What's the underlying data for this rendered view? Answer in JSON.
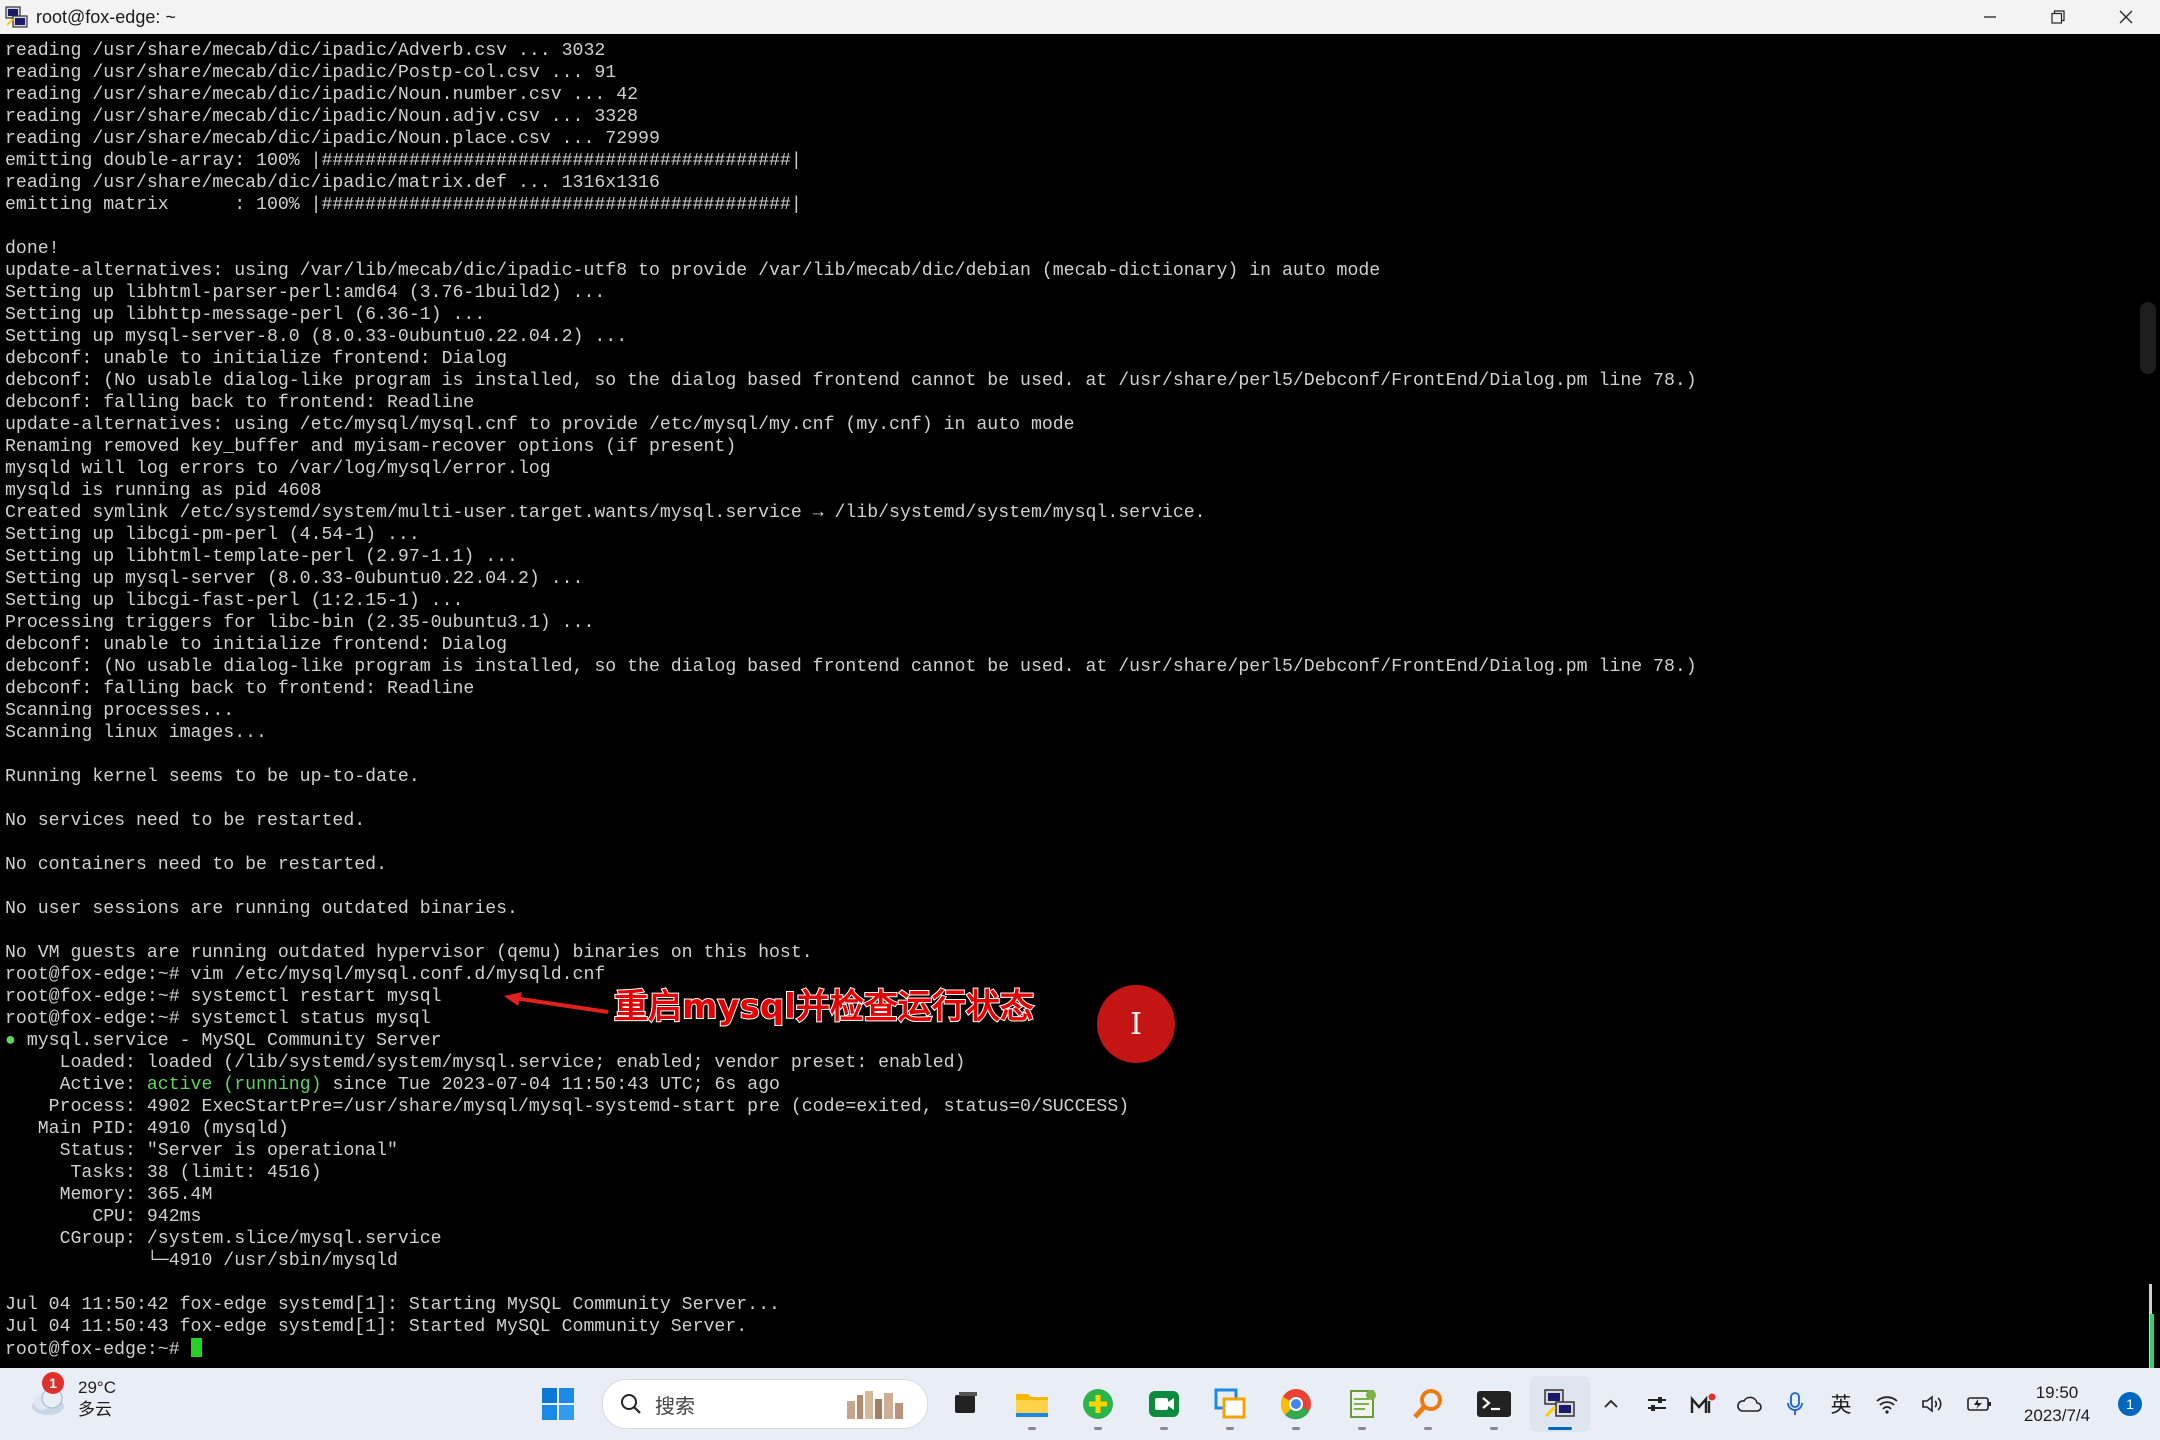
{
  "window": {
    "title": "root@fox-edge: ~"
  },
  "terminal": {
    "lines": [
      [
        {
          "t": "reading /usr/share/mecab/dic/ipadic/Adverb.csv ... 3032"
        }
      ],
      [
        {
          "t": "reading /usr/share/mecab/dic/ipadic/Postp-col.csv ... 91"
        }
      ],
      [
        {
          "t": "reading /usr/share/mecab/dic/ipadic/Noun.number.csv ... 42"
        }
      ],
      [
        {
          "t": "reading /usr/share/mecab/dic/ipadic/Noun.adjv.csv ... 3328"
        }
      ],
      [
        {
          "t": "reading /usr/share/mecab/dic/ipadic/Noun.place.csv ... 72999"
        }
      ],
      [
        {
          "t": "emitting double-array: 100% |###########################################|"
        }
      ],
      [
        {
          "t": "reading /usr/share/mecab/dic/ipadic/matrix.def ... 1316x1316"
        }
      ],
      [
        {
          "t": "emitting matrix      : 100% |###########################################|"
        }
      ],
      [
        {
          "t": ""
        }
      ],
      [
        {
          "t": "done!"
        }
      ],
      [
        {
          "t": "update-alternatives: using /var/lib/mecab/dic/ipadic-utf8 to provide /var/lib/mecab/dic/debian (mecab-dictionary) in auto mode"
        }
      ],
      [
        {
          "t": "Setting up libhtml-parser-perl:amd64 (3.76-1build2) ..."
        }
      ],
      [
        {
          "t": "Setting up libhttp-message-perl (6.36-1) ..."
        }
      ],
      [
        {
          "t": "Setting up mysql-server-8.0 (8.0.33-0ubuntu0.22.04.2) ..."
        }
      ],
      [
        {
          "t": "debconf: unable to initialize frontend: Dialog"
        }
      ],
      [
        {
          "t": "debconf: (No usable dialog-like program is installed, so the dialog based frontend cannot be used. at /usr/share/perl5/Debconf/FrontEnd/Dialog.pm line 78.)"
        }
      ],
      [
        {
          "t": "debconf: falling back to frontend: Readline"
        }
      ],
      [
        {
          "t": "update-alternatives: using /etc/mysql/mysql.cnf to provide /etc/mysql/my.cnf (my.cnf) in auto mode"
        }
      ],
      [
        {
          "t": "Renaming removed key_buffer and myisam-recover options (if present)"
        }
      ],
      [
        {
          "t": "mysqld will log errors to /var/log/mysql/error.log"
        }
      ],
      [
        {
          "t": "mysqld is running as pid 4608"
        }
      ],
      [
        {
          "t": "Created symlink /etc/systemd/system/multi-user.target.wants/mysql.service → /lib/systemd/system/mysql.service."
        }
      ],
      [
        {
          "t": "Setting up libcgi-pm-perl (4.54-1) ..."
        }
      ],
      [
        {
          "t": "Setting up libhtml-template-perl (2.97-1.1) ..."
        }
      ],
      [
        {
          "t": "Setting up mysql-server (8.0.33-0ubuntu0.22.04.2) ..."
        }
      ],
      [
        {
          "t": "Setting up libcgi-fast-perl (1:2.15-1) ..."
        }
      ],
      [
        {
          "t": "Processing triggers for libc-bin (2.35-0ubuntu3.1) ..."
        }
      ],
      [
        {
          "t": "debconf: unable to initialize frontend: Dialog"
        }
      ],
      [
        {
          "t": "debconf: (No usable dialog-like program is installed, so the dialog based frontend cannot be used. at /usr/share/perl5/Debconf/FrontEnd/Dialog.pm line 78.)"
        }
      ],
      [
        {
          "t": "debconf: falling back to frontend: Readline"
        }
      ],
      [
        {
          "t": "Scanning processes..."
        }
      ],
      [
        {
          "t": "Scanning linux images..."
        }
      ],
      [
        {
          "t": ""
        }
      ],
      [
        {
          "t": "Running kernel seems to be up-to-date."
        }
      ],
      [
        {
          "t": ""
        }
      ],
      [
        {
          "t": "No services need to be restarted."
        }
      ],
      [
        {
          "t": ""
        }
      ],
      [
        {
          "t": "No containers need to be restarted."
        }
      ],
      [
        {
          "t": ""
        }
      ],
      [
        {
          "t": "No user sessions are running outdated binaries."
        }
      ],
      [
        {
          "t": ""
        }
      ],
      [
        {
          "t": "No VM guests are running outdated hypervisor (qemu) binaries on this host."
        }
      ],
      [
        {
          "t": "root@fox-edge:~# vim /etc/mysql/mysql.conf.d/mysqld.cnf"
        }
      ],
      [
        {
          "t": "root@fox-edge:~# systemctl restart mysql"
        }
      ],
      [
        {
          "t": "root@fox-edge:~# systemctl status mysql"
        }
      ],
      [
        {
          "t": "●",
          "c": "dot"
        },
        {
          "t": " mysql.service - MySQL Community Server"
        }
      ],
      [
        {
          "t": "     Loaded: loaded (/lib/systemd/system/mysql.service; enabled; vendor preset: enabled)"
        }
      ],
      [
        {
          "t": "     Active: "
        },
        {
          "t": "active (running)",
          "c": "green"
        },
        {
          "t": " since Tue 2023-07-04 11:50:43 UTC; 6s ago"
        }
      ],
      [
        {
          "t": "    Process: 4902 ExecStartPre=/usr/share/mysql/mysql-systemd-start pre (code=exited, status=0/SUCCESS)"
        }
      ],
      [
        {
          "t": "   Main PID: 4910 (mysqld)"
        }
      ],
      [
        {
          "t": "     Status: \"Server is operational\""
        }
      ],
      [
        {
          "t": "      Tasks: 38 (limit: 4516)"
        }
      ],
      [
        {
          "t": "     Memory: 365.4M"
        }
      ],
      [
        {
          "t": "        CPU: 942ms"
        }
      ],
      [
        {
          "t": "     CGroup: /system.slice/mysql.service"
        }
      ],
      [
        {
          "t": "             └─4910 /usr/sbin/mysqld"
        }
      ],
      [
        {
          "t": ""
        }
      ],
      [
        {
          "t": "Jul 04 11:50:42 fox-edge systemd[1]: Starting MySQL Community Server..."
        }
      ],
      [
        {
          "t": "Jul 04 11:50:43 fox-edge systemd[1]: Started MySQL Community Server."
        }
      ],
      [
        {
          "t": "root@fox-edge:~# "
        },
        {
          "t": "",
          "c": "cursor"
        }
      ]
    ]
  },
  "annotation": {
    "text": "重启mysql并检查运行状态"
  },
  "click_marker": {
    "glyph": "I"
  },
  "taskbar": {
    "weather": {
      "temp": "29°C",
      "condition": "多云",
      "badge": "1"
    },
    "search_placeholder": "搜索",
    "apps": [
      {
        "name": "windows-start-icon",
        "active": false
      },
      {
        "name": "file-explorer-icon",
        "active": false
      },
      {
        "name": "green-plus-app-icon",
        "active": false
      },
      {
        "name": "video-meeting-icon",
        "active": false
      },
      {
        "name": "remote-window-icon",
        "active": false
      },
      {
        "name": "chrome-icon",
        "active": false
      },
      {
        "name": "notepad-plus-plus-icon",
        "active": false
      },
      {
        "name": "search-tool-icon",
        "active": false
      },
      {
        "name": "terminal-icon",
        "active": false
      },
      {
        "name": "putty-icon",
        "active": true
      }
    ],
    "tray": {
      "ime": "英",
      "time": "19:50",
      "date": "2023/7/4",
      "notifications": "1"
    }
  },
  "colors": {
    "terminal_bg": "#000000",
    "terminal_fg": "#d0d0d0",
    "active_green": "#5fd35f",
    "annotation_red": "#e60000",
    "accent": "#0067c0"
  }
}
